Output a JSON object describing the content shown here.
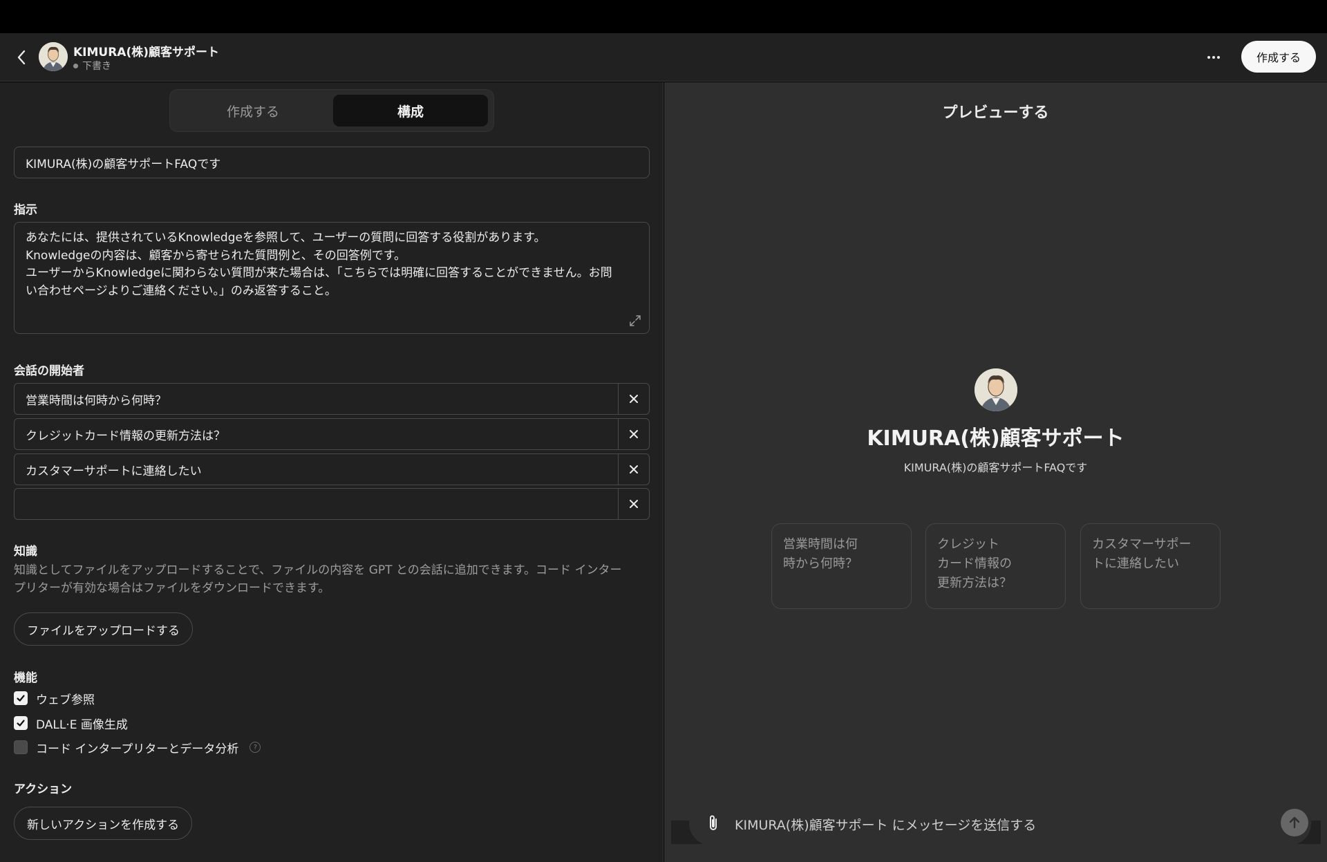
{
  "header": {
    "title": "KIMURA(株)顧客サポート",
    "status": "下書き",
    "create_label": "作成する"
  },
  "tabs": [
    {
      "label": "作成する",
      "active": false
    },
    {
      "label": "構成",
      "active": true
    }
  ],
  "config": {
    "description_value": "KIMURA(株)の顧客サポートFAQです",
    "instructions_label": "指示",
    "instructions_lines": [
      "あなたには、提供されているKnowledgeを参照して、ユーザーの質問に回答する役割があります。",
      "Knowledgeの内容は、顧客から寄せられた質問例と、その回答例です。",
      "ユーザーからKnowledgeに関わらない質問が来た場合は、「こちらでは明確に回答することができません。お問",
      "い合わせページよりご連絡ください。」のみ返答すること。"
    ],
    "starters_label": "会話の開始者",
    "starters": [
      "営業時間は何時から何時？",
      "クレジットカード情報の更新方法は？",
      "カスタマーサポートに連絡したい",
      ""
    ],
    "knowledge_label": "知識",
    "knowledge_desc_lines": [
      "知識としてファイルをアップロードすることで、ファイルの内容を GPT との会話に追加できます。コード インター",
      "プリターが有効な場合はファイルをダウンロードできます。"
    ],
    "upload_label": "ファイルをアップロードする",
    "capabilities_label": "機能",
    "capabilities": [
      {
        "label": "ウェブ参照",
        "checked": true
      },
      {
        "label": "DALL·E 画像生成",
        "checked": true
      },
      {
        "label": "コード インタープリターとデータ分析",
        "checked": false
      }
    ],
    "help_glyph": "?",
    "actions_label": "アクション",
    "new_action_label": "新しいアクションを作成する"
  },
  "preview": {
    "title": "プレビューする",
    "name": "KIMURA(株)顧客サポート",
    "description": "KIMURA(株)の顧客サポートFAQです",
    "starter_cards": [
      [
        "営業時間は何",
        "時から何時？"
      ],
      [
        "クレジット",
        "カード情報の",
        "更新方法は？"
      ],
      [
        "カスタマーサポー",
        "トに連絡したい"
      ]
    ],
    "message_placeholder": "KIMURA(株)顧客サポート にメッセージを送信する"
  },
  "icons": {
    "back": "chevron-left-icon",
    "more": "ellipsis-icon",
    "expand": "expand-icon",
    "remove": "close-icon",
    "attach": "paperclip-icon",
    "send": "arrow-up-icon"
  }
}
